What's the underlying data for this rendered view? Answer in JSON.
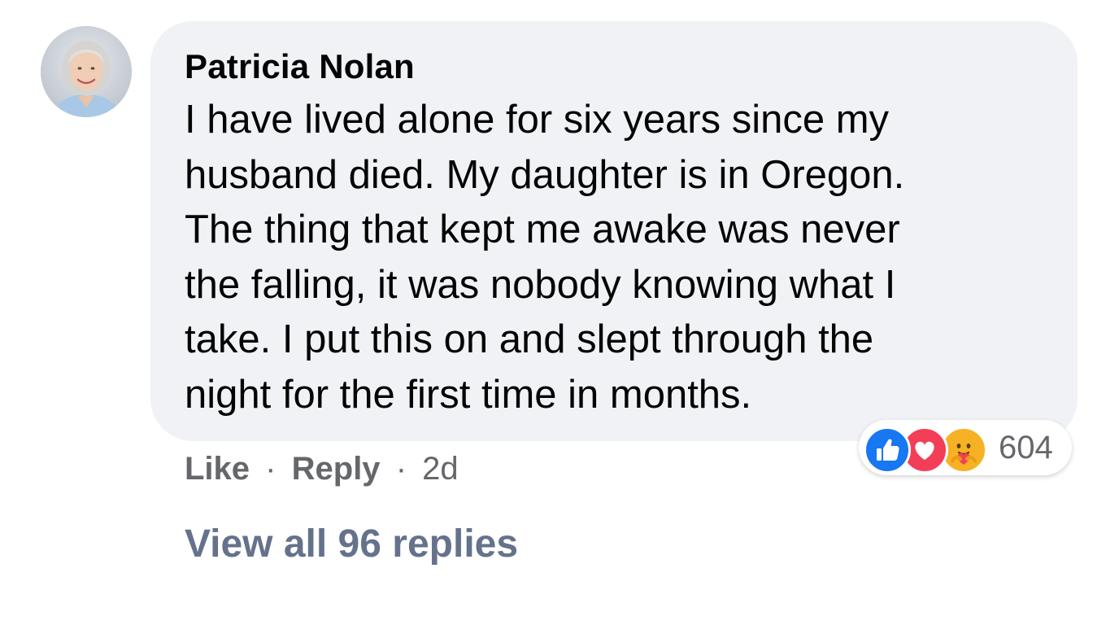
{
  "comment": {
    "author": "Patricia Nolan",
    "avatar_alt": "Patricia Nolan",
    "body_lines": [
      "I have lived alone for six years since my",
      "husband died. My daughter is in Oregon.",
      "The thing that kept me awake was never",
      "the falling, it was nobody knowing what I",
      "take. I put this on and slept through the",
      "night for the first time in months."
    ],
    "reactions": {
      "icons": [
        "like-icon",
        "love-icon",
        "care-icon"
      ],
      "count": "604",
      "colors": {
        "like": "#1877f2",
        "love": "#f33e58",
        "care": "#f7b125"
      }
    },
    "actions": {
      "like_label": "Like",
      "separator": "·",
      "reply_label": "Reply",
      "timestamp": "2d"
    },
    "view_replies_label": "View all 96 replies"
  },
  "colors": {
    "bubble_bg": "#f0f2f5",
    "text": "#050505",
    "secondary_text": "#65676b",
    "replies_link": "#65728b"
  }
}
